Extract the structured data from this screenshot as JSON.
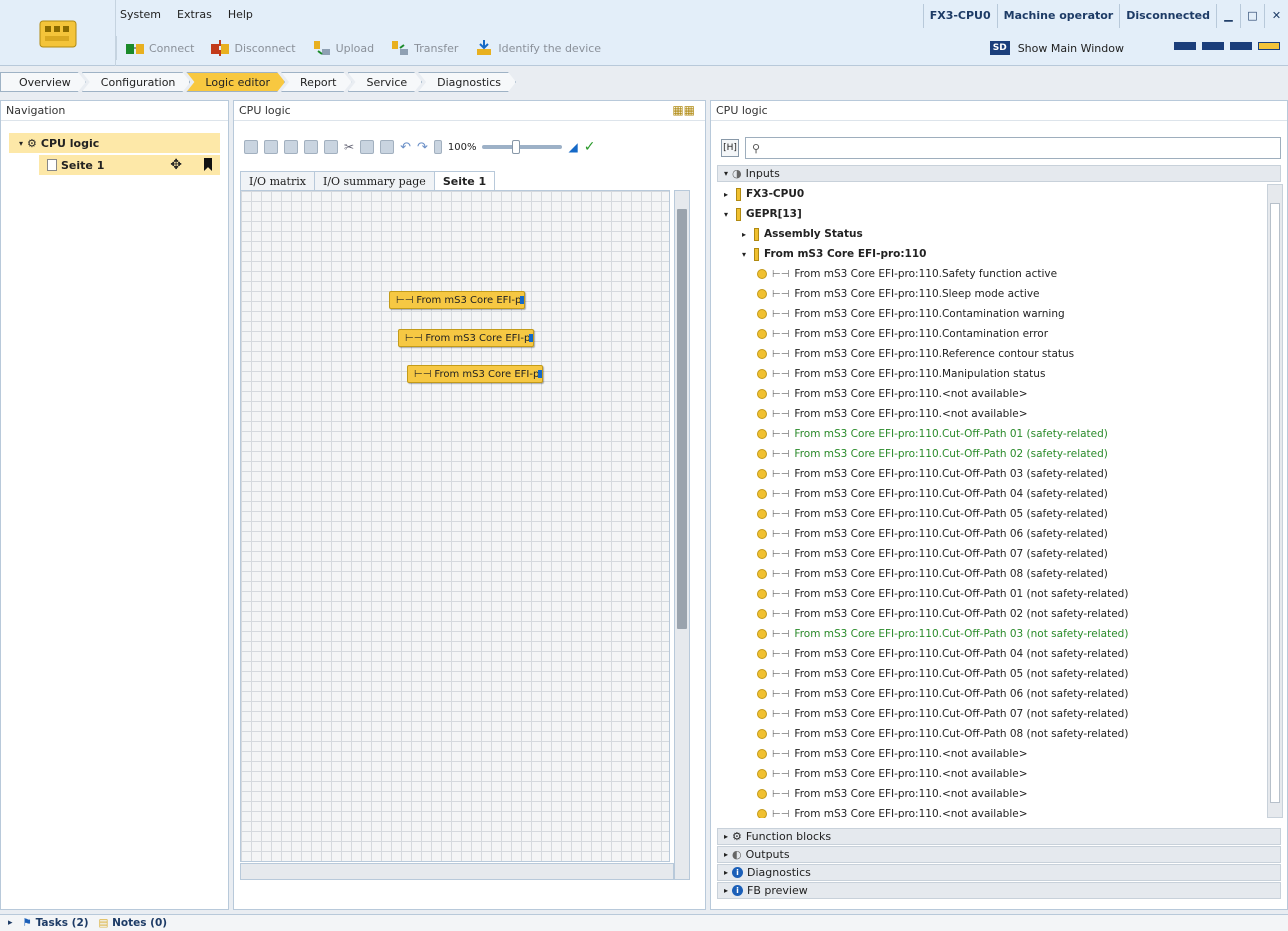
{
  "menu": [
    "System",
    "Extras",
    "Help"
  ],
  "toolbar": {
    "connect": "Connect",
    "disconnect": "Disconnect",
    "upload": "Upload",
    "transfer": "Transfer",
    "identify": "Identify the device"
  },
  "status": {
    "device": "FX3-CPU0",
    "user": "Machine operator",
    "connection": "Disconnected"
  },
  "show_main": {
    "badge": "SD",
    "label": "Show Main Window"
  },
  "tabs": [
    "Overview",
    "Configuration",
    "Logic editor",
    "Report",
    "Service",
    "Diagnostics"
  ],
  "active_tab": "Logic editor",
  "navigation": {
    "title": "Navigation",
    "root": "CPU logic",
    "child": "Seite 1"
  },
  "center": {
    "title": "CPU logic",
    "zoom": "100%",
    "subtabs": [
      "I/O matrix",
      "I/O summary page",
      "Seite 1"
    ],
    "blocks": [
      "From mS3 Core EFI-pro",
      "From mS3 Core EFI-pro",
      "From mS3 Core EFI-pro"
    ]
  },
  "right": {
    "title": "CPU logic",
    "search_placeholder": "",
    "inputs_label": "Inputs",
    "tree": [
      {
        "label": "FX3-CPU0",
        "level": 0,
        "bold": true,
        "arrow": "▸",
        "icon": "folder"
      },
      {
        "label": "GEPR[13]",
        "level": 0,
        "bold": true,
        "arrow": "▾",
        "icon": "folder"
      },
      {
        "label": "Assembly Status",
        "level": 1,
        "bold": true,
        "arrow": "▸",
        "icon": "folder"
      },
      {
        "label": "From mS3 Core EFI-pro:110",
        "level": 1,
        "bold": true,
        "arrow": "▾",
        "icon": "folder"
      },
      {
        "label": "From mS3 Core EFI-pro:110.Safety function active",
        "level": 2
      },
      {
        "label": "From mS3 Core EFI-pro:110.Sleep mode active",
        "level": 2
      },
      {
        "label": "From mS3 Core EFI-pro:110.Contamination warning",
        "level": 2
      },
      {
        "label": "From mS3 Core EFI-pro:110.Contamination error",
        "level": 2
      },
      {
        "label": "From mS3 Core EFI-pro:110.Reference contour status",
        "level": 2
      },
      {
        "label": "From mS3 Core EFI-pro:110.Manipulation status",
        "level": 2
      },
      {
        "label": "From mS3 Core EFI-pro:110.<not available>",
        "level": 2
      },
      {
        "label": "From mS3 Core EFI-pro:110.<not available>",
        "level": 2
      },
      {
        "label": "From mS3 Core EFI-pro:110.Cut-Off-Path 01 (safety-related)",
        "level": 2,
        "green": true
      },
      {
        "label": "From mS3 Core EFI-pro:110.Cut-Off-Path 02 (safety-related)",
        "level": 2,
        "green": true
      },
      {
        "label": "From mS3 Core EFI-pro:110.Cut-Off-Path 03 (safety-related)",
        "level": 2
      },
      {
        "label": "From mS3 Core EFI-pro:110.Cut-Off-Path 04 (safety-related)",
        "level": 2
      },
      {
        "label": "From mS3 Core EFI-pro:110.Cut-Off-Path 05 (safety-related)",
        "level": 2
      },
      {
        "label": "From mS3 Core EFI-pro:110.Cut-Off-Path 06 (safety-related)",
        "level": 2
      },
      {
        "label": "From mS3 Core EFI-pro:110.Cut-Off-Path 07 (safety-related)",
        "level": 2
      },
      {
        "label": "From mS3 Core EFI-pro:110.Cut-Off-Path 08 (safety-related)",
        "level": 2
      },
      {
        "label": "From mS3 Core EFI-pro:110.Cut-Off-Path 01 (not safety-related)",
        "level": 2
      },
      {
        "label": "From mS3 Core EFI-pro:110.Cut-Off-Path 02 (not safety-related)",
        "level": 2
      },
      {
        "label": "From mS3 Core EFI-pro:110.Cut-Off-Path 03 (not safety-related)",
        "level": 2,
        "green": true
      },
      {
        "label": "From mS3 Core EFI-pro:110.Cut-Off-Path 04 (not safety-related)",
        "level": 2
      },
      {
        "label": "From mS3 Core EFI-pro:110.Cut-Off-Path 05 (not safety-related)",
        "level": 2
      },
      {
        "label": "From mS3 Core EFI-pro:110.Cut-Off-Path 06 (not safety-related)",
        "level": 2
      },
      {
        "label": "From mS3 Core EFI-pro:110.Cut-Off-Path 07 (not safety-related)",
        "level": 2
      },
      {
        "label": "From mS3 Core EFI-pro:110.Cut-Off-Path 08 (not safety-related)",
        "level": 2
      },
      {
        "label": "From mS3 Core EFI-pro:110.<not available>",
        "level": 2
      },
      {
        "label": "From mS3 Core EFI-pro:110.<not available>",
        "level": 2
      },
      {
        "label": "From mS3 Core EFI-pro:110.<not available>",
        "level": 2
      },
      {
        "label": "From mS3 Core EFI-pro:110.<not available>",
        "level": 2
      }
    ],
    "sections": [
      "Function blocks",
      "Outputs",
      "Diagnostics",
      "FB preview"
    ]
  },
  "bottom": {
    "tasks": "Tasks (2)",
    "notes": "Notes (0)"
  },
  "colors": {
    "accent": "#f8c840",
    "brand": "#1b3e7b",
    "green_text": "#2a8a2a"
  }
}
